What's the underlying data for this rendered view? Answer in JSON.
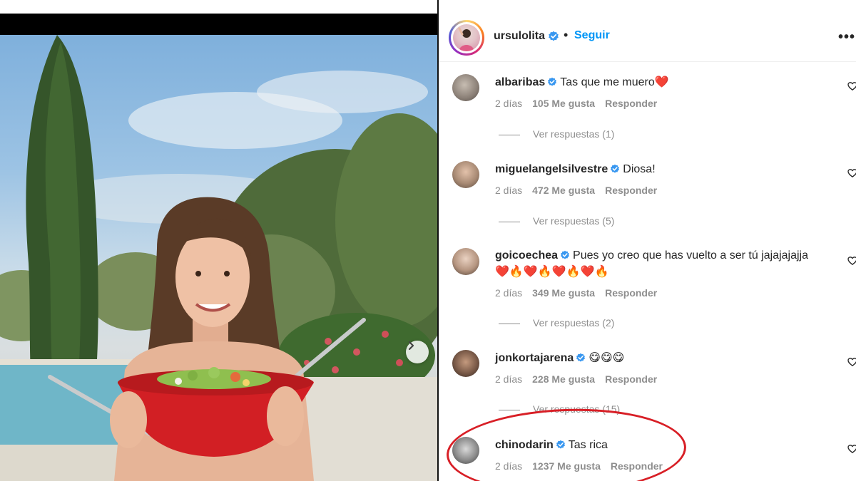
{
  "post": {
    "username": "ursulolita",
    "verified": true,
    "separator": "•",
    "follow_label": "Seguir",
    "more_label": "•••"
  },
  "carousel": {
    "next_icon": "chevron-right-icon"
  },
  "comments": [
    {
      "username": "albaribas",
      "text": "Tas que me muero❤️",
      "time": "2 días",
      "likes": "105 Me gusta",
      "reply_label": "Responder",
      "replies_label": "Ver respuestas (1)"
    },
    {
      "username": "miguelangelsilvestre",
      "text": "Diosa!",
      "time": "2 días",
      "likes": "472 Me gusta",
      "reply_label": "Responder",
      "replies_label": "Ver respuestas (5)"
    },
    {
      "username": "goicoechea",
      "text": "Pues yo creo que has vuelto a ser tú jajajajajja",
      "text_line2": "❤️🔥❤️🔥❤️🔥❤️🔥",
      "time": "2 días",
      "likes": "349 Me gusta",
      "reply_label": "Responder",
      "replies_label": "Ver respuestas (2)"
    },
    {
      "username": "jonkortajarena",
      "text": "😋😋😋",
      "time": "2 días",
      "likes": "228 Me gusta",
      "reply_label": "Responder",
      "replies_label": "Ver respuestas (15)"
    },
    {
      "username": "chinodarin",
      "text": "Tas rica",
      "time": "2 días",
      "likes": "1237 Me gusta",
      "reply_label": "Responder"
    }
  ],
  "colors": {
    "accent_follow": "#0095f6",
    "verified": "#3897f0",
    "meta_gray": "#8e8e8e",
    "highlight_red": "#d81f26"
  }
}
